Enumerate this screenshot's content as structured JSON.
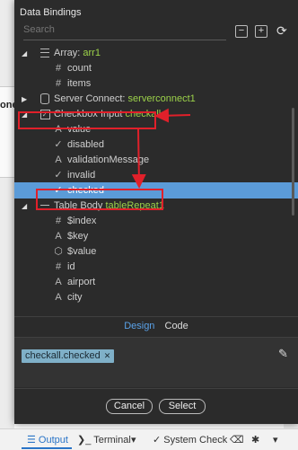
{
  "background": {
    "partial_text": "one"
  },
  "dialog": {
    "title": "Data Bindings",
    "search_placeholder": "Search",
    "toolbar": {
      "collapse": "−",
      "expand": "+",
      "refresh": "⟳"
    }
  },
  "tree": [
    {
      "arrow": "◢",
      "icon": "lines",
      "label": "Array:",
      "value": "arr1"
    },
    {
      "icon": "#",
      "label": "count"
    },
    {
      "icon": "#",
      "label": "items"
    },
    {
      "arrow": "▶",
      "icon": "db",
      "label": "Server Connect:",
      "value": "serverconnect1"
    },
    {
      "arrow": "◢",
      "icon": "checkbox",
      "label": "Checkbox Input",
      "value": "checkall"
    },
    {
      "icon": "A",
      "label": "value"
    },
    {
      "icon": "✓",
      "label": "disabled"
    },
    {
      "icon": "A",
      "label": "validationMessage"
    },
    {
      "icon": "✓",
      "label": "invalid"
    },
    {
      "icon": "✓",
      "label": "checked",
      "selected": true
    },
    {
      "arrow": "◢",
      "icon": "dash",
      "label": "Table Body",
      "value": "tableRepeat1"
    },
    {
      "icon": "#",
      "label": "$index"
    },
    {
      "icon": "A",
      "label": "$key"
    },
    {
      "icon": "⬡",
      "label": "$value"
    },
    {
      "icon": "#",
      "label": "id"
    },
    {
      "icon": "A",
      "label": "airport"
    },
    {
      "icon": "A",
      "label": "city"
    }
  ],
  "tabs": {
    "design": "Design",
    "code": "Code"
  },
  "expression_chip": "checkall.checked",
  "buttons": {
    "cancel": "Cancel",
    "select": "Select"
  },
  "statusbar": {
    "output": "Output",
    "terminal": "Terminal",
    "system_check": "System Check"
  },
  "colors": {
    "accent": "#5b9bd8",
    "binding_value": "#9cd24a",
    "annotation_red": "#e0202a"
  }
}
